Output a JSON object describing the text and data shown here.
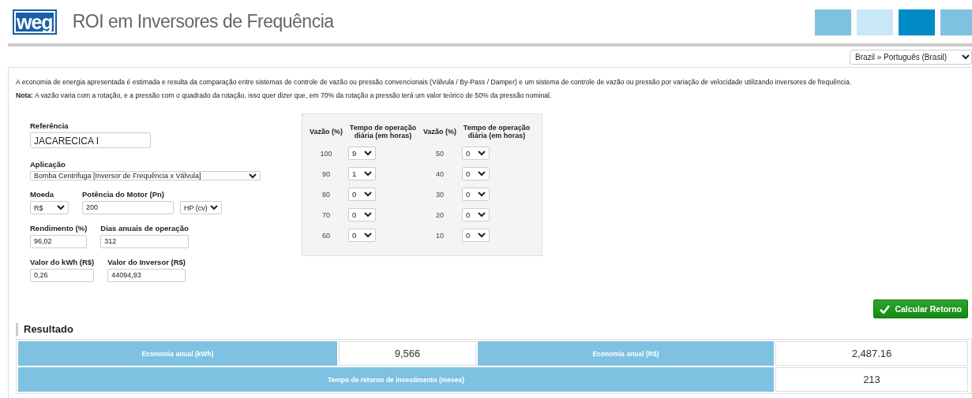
{
  "header": {
    "logo": "weg",
    "title": "ROI em Inversores de Frequência",
    "tiles": [
      {
        "color": "#7fc1e0"
      },
      {
        "color": "#c8e8f8"
      },
      {
        "color": "#008bc7"
      },
      {
        "color": "#7fc1e0"
      }
    ]
  },
  "language_select": {
    "value": "Brazil » Português (Brasil)"
  },
  "intro": [
    "A economia de energia apresentada é estimada e resulta da comparação entre sistemas de controle de vazão ou pressão convencionais (Válvula / By-Pass / Damper) e um sistema de controle de vazão ou pressão por variação de velocidade utilizando inversores de frequência.",
    "**Nota:** A vazão varia com a rotação, e a pressão com o quadrado da rotação, isso quer dizer que, em 70% da rotação a pressão terá um valor teórico de 50% da pressão nominal."
  ],
  "form": {
    "reference": {
      "label": "Referência",
      "value": "JACARECICA I"
    },
    "application": {
      "label": "Aplicação",
      "value": "Bomba Centrifuga [Inversor de Frequência x Válvula]"
    },
    "currency": {
      "label": "Moeda",
      "value": "R$"
    },
    "motor_power": {
      "label": "Potência do Motor (Pn)",
      "value": "200",
      "unit": "HP (cv)"
    },
    "efficiency": {
      "label": "Rendimento (%)",
      "value": "96,02"
    },
    "annual_days": {
      "label": "Dias anuais de operação",
      "value": "312"
    },
    "kwh_price": {
      "label": "Valor do kWh (R$)",
      "value": "0,26"
    },
    "inverter_price": {
      "label": "Valor do Inversor (R$)",
      "value": "44094,93"
    }
  },
  "flow_table": {
    "columns": [
      "Vazão (%)",
      "Tempo de operação diária (em horas)",
      "Vazão (%)",
      "Tempo de operação diária (em horas)"
    ],
    "rows": [
      {
        "flow_a": "100",
        "hours_a": "9",
        "flow_b": "50",
        "hours_b": "0"
      },
      {
        "flow_a": "90",
        "hours_a": "1",
        "flow_b": "40",
        "hours_b": "0"
      },
      {
        "flow_a": "80",
        "hours_a": "0",
        "flow_b": "30",
        "hours_b": "0"
      },
      {
        "flow_a": "70",
        "hours_a": "0",
        "flow_b": "20",
        "hours_b": "0"
      },
      {
        "flow_a": "60",
        "hours_a": "0",
        "flow_b": "10",
        "hours_b": "0"
      }
    ]
  },
  "calculate_button": "Calcular Retorno",
  "result": {
    "title": "Resultado",
    "rows": [
      {
        "items": [
          {
            "label": "Economia anual (kWh)",
            "value": "9,566"
          },
          {
            "label": "Economia anual (R$)",
            "value": "2,487.16"
          }
        ]
      },
      {
        "items": [
          {
            "label": "Tempo de retorno de investimento (meses)",
            "value": "213"
          }
        ]
      }
    ]
  }
}
